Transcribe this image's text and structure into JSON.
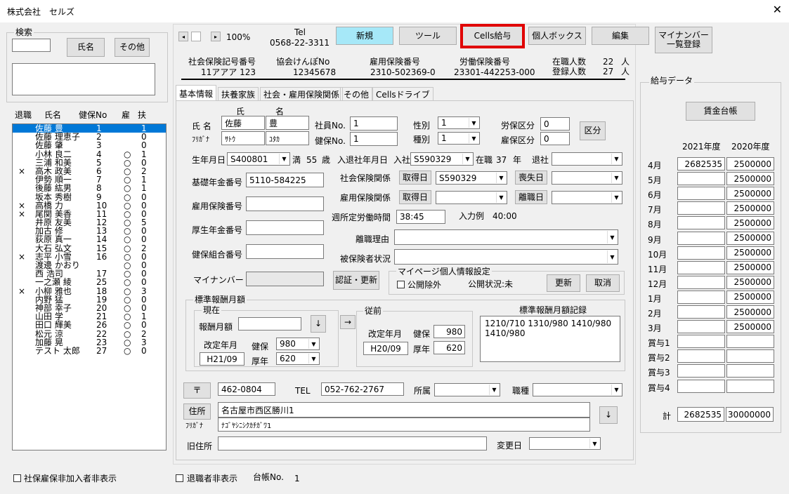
{
  "window": {
    "title": "株式会社　セルズ",
    "close": "✕"
  },
  "search": {
    "title": "検索",
    "name_btn": "氏名",
    "other_btn": "その他"
  },
  "list": {
    "headers": {
      "retire": "退職",
      "name": "氏名",
      "kenpo": "健保No",
      "ko": "雇",
      "fu": "扶"
    },
    "rows": [
      {
        "r": "",
        "n": "佐藤 豊",
        "k": "1",
        "y": "",
        "f": "1"
      },
      {
        "r": "",
        "n": "佐藤 理恵子",
        "k": "2",
        "y": "",
        "f": "0"
      },
      {
        "r": "",
        "n": "佐藤 肇",
        "k": "3",
        "y": "",
        "f": "0"
      },
      {
        "r": "",
        "n": "小林 良二",
        "k": "4",
        "y": "○",
        "f": "1"
      },
      {
        "r": "",
        "n": "三浦 和美",
        "k": "5",
        "y": "○",
        "f": "0"
      },
      {
        "r": "×",
        "n": "高木 政美",
        "k": "6",
        "y": "○",
        "f": "2"
      },
      {
        "r": "",
        "n": "伊勢 順一",
        "k": "7",
        "y": "○",
        "f": "1"
      },
      {
        "r": "",
        "n": "後藤 紘男",
        "k": "8",
        "y": "○",
        "f": "1"
      },
      {
        "r": "",
        "n": "坂本 秀樹",
        "k": "9",
        "y": "○",
        "f": "0"
      },
      {
        "r": "×",
        "n": "高橋 力",
        "k": "10",
        "y": "○",
        "f": "0"
      },
      {
        "r": "×",
        "n": "尾関 美香",
        "k": "11",
        "y": "○",
        "f": "0"
      },
      {
        "r": "",
        "n": "井原 友美",
        "k": "12",
        "y": "○",
        "f": "5"
      },
      {
        "r": "",
        "n": "加古 修",
        "k": "13",
        "y": "○",
        "f": "0"
      },
      {
        "r": "",
        "n": "荻原 真一",
        "k": "14",
        "y": "○",
        "f": "0"
      },
      {
        "r": "",
        "n": "大石 弘文",
        "k": "15",
        "y": "○",
        "f": "2"
      },
      {
        "r": "×",
        "n": "志平 小雪",
        "k": "16",
        "y": "○",
        "f": "0"
      },
      {
        "r": "",
        "n": "渡邊 かおり",
        "k": "",
        "y": "○",
        "f": "0"
      },
      {
        "r": "",
        "n": "西 浩司",
        "k": "17",
        "y": "○",
        "f": "0"
      },
      {
        "r": "",
        "n": "一之瀬 綾",
        "k": "25",
        "y": "○",
        "f": "0"
      },
      {
        "r": "×",
        "n": "小柳 雅也",
        "k": "18",
        "y": "○",
        "f": "3"
      },
      {
        "r": "",
        "n": "内野 猛",
        "k": "19",
        "y": "○",
        "f": "0"
      },
      {
        "r": "",
        "n": "神部 幸子",
        "k": "20",
        "y": "○",
        "f": "0"
      },
      {
        "r": "",
        "n": "山田 学",
        "k": "21",
        "y": "○",
        "f": "1"
      },
      {
        "r": "",
        "n": "田口 輝美",
        "k": "26",
        "y": "○",
        "f": "0"
      },
      {
        "r": "",
        "n": "松元 涼",
        "k": "22",
        "y": "○",
        "f": "2"
      },
      {
        "r": "",
        "n": "加藤 晃",
        "k": "23",
        "y": "○",
        "f": "3"
      },
      {
        "r": "",
        "n": "テスト 太郎",
        "k": "27",
        "y": "○",
        "f": "0"
      }
    ]
  },
  "bottom_left": {
    "hide_unenrolled": "社保雇保非加入者非表示"
  },
  "bottom": {
    "hide_retired": "退職者非表示",
    "ledger_label": "台帳No.",
    "ledger_no": "1"
  },
  "toolbar": {
    "zoom": "100%",
    "tel_label": "Tel",
    "tel": "0568-22-3311",
    "new": "新規",
    "tools": "ツール",
    "cells_kyuyo": "Cells給与",
    "personal_box": "個人ボックス",
    "edit": "編集",
    "mynumber": "マイナンバー\n一覧登録",
    "scroll_left": "◂",
    "scroll_right": "▸"
  },
  "company": {
    "shaho_label": "社会保険記号番号",
    "shaho": "11アアア 123",
    "kyokai_label": "協会けんぽNo",
    "kyokai": "12345678",
    "koyo_label": "雇用保険番号",
    "koyo": "2310-502369-0",
    "rodo_label": "労働保険番号",
    "rodo": "23301-442253-000",
    "zaishoku_label": "在職人数",
    "zaishoku": "22",
    "toroku_label": "登録人数",
    "toroku": "27",
    "nin": "人"
  },
  "tabs": [
    "基本情報",
    "扶養家族",
    "社会・雇用保険関係",
    "その他",
    "Cellsドライブ"
  ],
  "basic": {
    "uji_label": "氏",
    "mei_label": "名",
    "name_label": "氏 名",
    "furigana_label": "ﾌﾘｶﾞﾅ",
    "last_name": "佐藤",
    "first_name": "豊",
    "last_kana": "ｻﾄｳ",
    "first_kana": "ﾕﾀｶ",
    "emp_no_label": "社員No.",
    "emp_no": "1",
    "kenpo_no_label": "健保No.",
    "kenpo_no": "1",
    "sex_label": "性別",
    "sex": "1",
    "kind_label": "種別",
    "kind": "1",
    "rosai_label": "労保区分",
    "rosai": "0",
    "koyo_kubun_label": "雇保区分",
    "koyo_kubun": "0",
    "kubun_btn": "区分",
    "birth_label": "生年月日",
    "birth": "S400801",
    "age_prefix": "満",
    "age": "55",
    "age_suffix": "歳",
    "nyutai_label": "入退社年月日",
    "nyusha_label": "入社",
    "nyusha": "S590329",
    "zaishoku_label": "在職",
    "zaishoku_years": "37",
    "nen": "年",
    "taisha_label": "退社",
    "kiso_label": "基礎年金番号",
    "kiso": "5110-584225",
    "shaho_kankei_label": "社会保険関係",
    "shutoku_btn": "取得日",
    "shaho_shutoku": "S590329",
    "soshitsu_btn": "喪失日",
    "koyo_no_label": "雇用保険番号",
    "koyo_kankei_label": "雇用保険関係",
    "koyo_shutoku_btn": "取得日",
    "rishoku_btn": "離職日",
    "roudou_label": "週所定労働時間",
    "roudou": "38:45",
    "example": "入力例　40:00",
    "kosei_label": "厚生年金番号",
    "rishoku_riyu_label": "離職理由",
    "kumiai_label": "健保組合番号",
    "hihoken_label": "被保険者状況",
    "mynumber_label": "マイナンバー",
    "ninsho_btn": "認証・更新",
    "mypage_title": "マイページ個人情報設定",
    "mypage_exclude": "公開除外",
    "mypage_status": "公開状況:未",
    "update_btn": "更新",
    "cancel_btn": "取消",
    "hyojun_title": "標準報酬月額",
    "genzai_title": "現在",
    "hoshu_label": "報酬月額",
    "down": "↓",
    "right": "→",
    "kaitei_label": "改定年月",
    "kaitei": "H21/09",
    "kenpo_label": "健保",
    "kenpo_val": "980",
    "kosei_short": "厚年",
    "kosei_val": "620",
    "juzen_title": "従前",
    "juzen_kaitei_label": "改定年月",
    "juzen_kaitei": "H20/09",
    "juzen_kenpo": "980",
    "juzen_kosei": "620",
    "kiroku_title": "標準報酬月額記録",
    "kiroku": "1210/710  1310/980 1410/980\n1410/980",
    "zip_btn": "〒",
    "zip": "462-0804",
    "tel_label": "TEL",
    "tel": "052-762-2767",
    "shozoku_label": "所属",
    "shokushu_label": "職種",
    "address_btn": "住所",
    "address": "名古屋市西区勝川1",
    "address_kana_label": "ﾌﾘｶﾞﾅ",
    "address_kana": "ﾅｺﾞﾔｼﾆｼｸｶﾁｶﾞﾜ1",
    "old_address_label": "旧住所",
    "change_date_label": "変更日"
  },
  "salary": {
    "title": "給与データ",
    "ledger_btn": "賃金台帳",
    "year1": "2021年度",
    "year2": "2020年度",
    "months": [
      {
        "m": "4月",
        "a": "2682535",
        "b": "2500000"
      },
      {
        "m": "5月",
        "a": "",
        "b": "2500000"
      },
      {
        "m": "6月",
        "a": "",
        "b": "2500000"
      },
      {
        "m": "7月",
        "a": "",
        "b": "2500000"
      },
      {
        "m": "8月",
        "a": "",
        "b": "2500000"
      },
      {
        "m": "9月",
        "a": "",
        "b": "2500000"
      },
      {
        "m": "10月",
        "a": "",
        "b": "2500000"
      },
      {
        "m": "11月",
        "a": "",
        "b": "2500000"
      },
      {
        "m": "12月",
        "a": "",
        "b": "2500000"
      },
      {
        "m": "1月",
        "a": "",
        "b": "2500000"
      },
      {
        "m": "2月",
        "a": "",
        "b": "2500000"
      },
      {
        "m": "3月",
        "a": "",
        "b": "2500000"
      },
      {
        "m": "賞与1",
        "a": "",
        "b": ""
      },
      {
        "m": "賞与2",
        "a": "",
        "b": ""
      },
      {
        "m": "賞与3",
        "a": "",
        "b": ""
      },
      {
        "m": "賞与4",
        "a": "",
        "b": ""
      }
    ],
    "total_label": "計",
    "total1": "2682535",
    "total2": "30000000"
  },
  "colors": {
    "new_btn": "#a6e8f8",
    "highlight": "#e00000",
    "selection": "#0078d7"
  }
}
